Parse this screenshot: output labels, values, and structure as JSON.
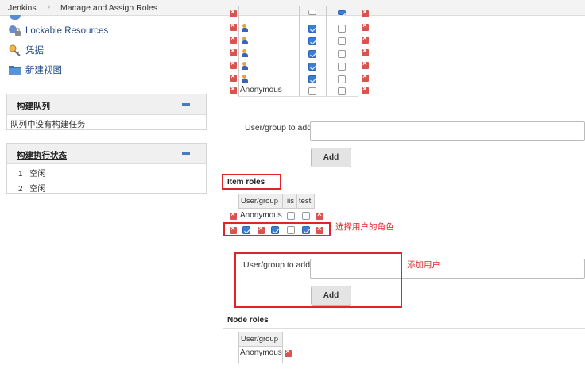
{
  "breadcrumb": {
    "home": "Jenkins",
    "separator": "›",
    "current": "Manage and Assign Roles"
  },
  "sidebar": {
    "links": [
      {
        "label": "Lockable Resources",
        "icon": "lock-resource-icon"
      },
      {
        "label": "凭据",
        "icon": "credentials-key-icon"
      },
      {
        "label": "新建视图",
        "icon": "folder-icon"
      }
    ],
    "build_queue": {
      "title": "构建队列",
      "empty_text": "队列中没有构建任务"
    },
    "executor_status": {
      "title": "构建执行状态",
      "executors": [
        {
          "num": "1",
          "state": "空闲"
        },
        {
          "num": "2",
          "state": "空闲"
        }
      ]
    }
  },
  "global_roles": {
    "rows": [
      {
        "name": "",
        "c1": true,
        "c2": false
      },
      {
        "name": "",
        "c1": true,
        "c2": false
      },
      {
        "name": "",
        "c1": true,
        "c2": false
      },
      {
        "name": "",
        "c1": true,
        "c2": false
      },
      {
        "name": "Anonymous",
        "c1": false,
        "c2": false
      }
    ],
    "add_label": "User/group to add",
    "add_value": "",
    "add_button": "Add"
  },
  "item_roles": {
    "title": "Item roles",
    "headers": [
      "User/group",
      "iis",
      "test"
    ],
    "rows": [
      {
        "name": "Anonymous",
        "iis": false,
        "test": false
      },
      {
        "name": "",
        "iis": false,
        "test": true
      }
    ],
    "add_label": "User/group to add",
    "add_value": "",
    "add_button": "Add"
  },
  "node_roles": {
    "title": "Node roles",
    "headers": [
      "User/group"
    ],
    "rows": [
      {
        "name": "Anonymous"
      }
    ]
  },
  "annotations": {
    "select_role": "选择用户的角色",
    "add_user": "添加用户"
  },
  "colors": {
    "annotation_red": "#e0242a",
    "checkbox_blue": "#3a7fd5",
    "delete_red": "#d9534f"
  }
}
